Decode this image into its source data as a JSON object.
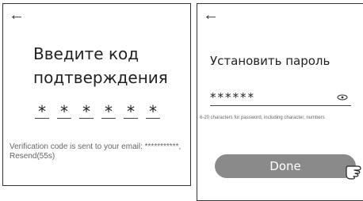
{
  "icons": {
    "back": "back-arrow-icon",
    "eye": "eye-icon",
    "hand": "tap-hand-icon"
  },
  "left_screen": {
    "back_glyph": "←",
    "heading": "Введите код подтверждения",
    "code_cells": [
      "*",
      "*",
      "*",
      "*",
      "*",
      "*"
    ],
    "note": "Verification code is sent to your email: ***********, Resend(55s)"
  },
  "right_screen": {
    "back_glyph": "←",
    "heading": "Установить пароль",
    "password_value": "******",
    "hint": "6-20 characters for password, including character, numbers",
    "done_label": "Done"
  },
  "colors": {
    "done_button": "#8a8a8a",
    "border": "#333333"
  }
}
